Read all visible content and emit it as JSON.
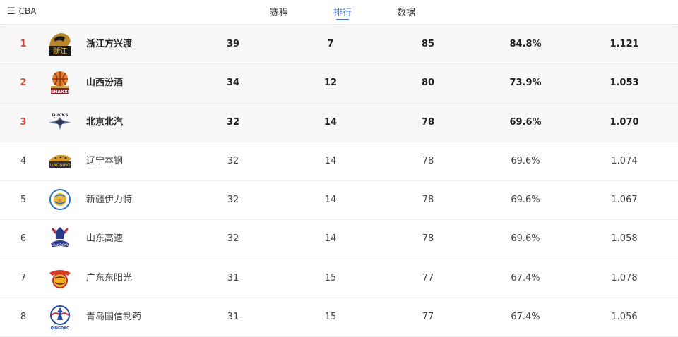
{
  "header": {
    "menu_label": "CBA",
    "tabs": [
      {
        "label": "赛程",
        "active": false
      },
      {
        "label": "排行",
        "active": true
      },
      {
        "label": "数据",
        "active": false
      }
    ]
  },
  "standings": [
    {
      "rank": "1",
      "team": "浙江方兴渡",
      "wins": "39",
      "losses": "7",
      "points": "85",
      "win_pct": "84.8%",
      "ratio": "1.121",
      "logo_icon": "zhejiang-lion-logo",
      "highlight": true
    },
    {
      "rank": "2",
      "team": "山西汾酒",
      "wins": "34",
      "losses": "12",
      "points": "80",
      "win_pct": "73.9%",
      "ratio": "1.053",
      "logo_icon": "shanxi-basketball-logo",
      "highlight": true
    },
    {
      "rank": "3",
      "team": "北京北汽",
      "wins": "32",
      "losses": "14",
      "points": "78",
      "win_pct": "69.6%",
      "ratio": "1.070",
      "logo_icon": "beijing-ducks-logo",
      "highlight": true
    },
    {
      "rank": "4",
      "team": "辽宁本钢",
      "wins": "32",
      "losses": "14",
      "points": "78",
      "win_pct": "69.6%",
      "ratio": "1.074",
      "logo_icon": "liaoning-leopards-logo",
      "highlight": false
    },
    {
      "rank": "5",
      "team": "新疆伊力特",
      "wins": "32",
      "losses": "14",
      "points": "78",
      "win_pct": "69.6%",
      "ratio": "1.067",
      "logo_icon": "xinjiang-tigers-logo",
      "highlight": false
    },
    {
      "rank": "6",
      "team": "山东高速",
      "wins": "32",
      "losses": "14",
      "points": "78",
      "win_pct": "69.6%",
      "ratio": "1.058",
      "logo_icon": "shandong-dragon-logo",
      "highlight": false
    },
    {
      "rank": "7",
      "team": "广东东阳光",
      "wins": "31",
      "losses": "15",
      "points": "77",
      "win_pct": "67.4%",
      "ratio": "1.078",
      "logo_icon": "guangdong-tigers-logo",
      "highlight": false
    },
    {
      "rank": "8",
      "team": "青岛国信制药",
      "wins": "31",
      "losses": "15",
      "points": "77",
      "win_pct": "67.4%",
      "ratio": "1.056",
      "logo_icon": "qingdao-eagles-logo",
      "highlight": false
    }
  ],
  "colors": {
    "accent": "#3b6fd8",
    "top_rank": "#d44a3a",
    "highlight_bg": "#f7f7f7"
  }
}
